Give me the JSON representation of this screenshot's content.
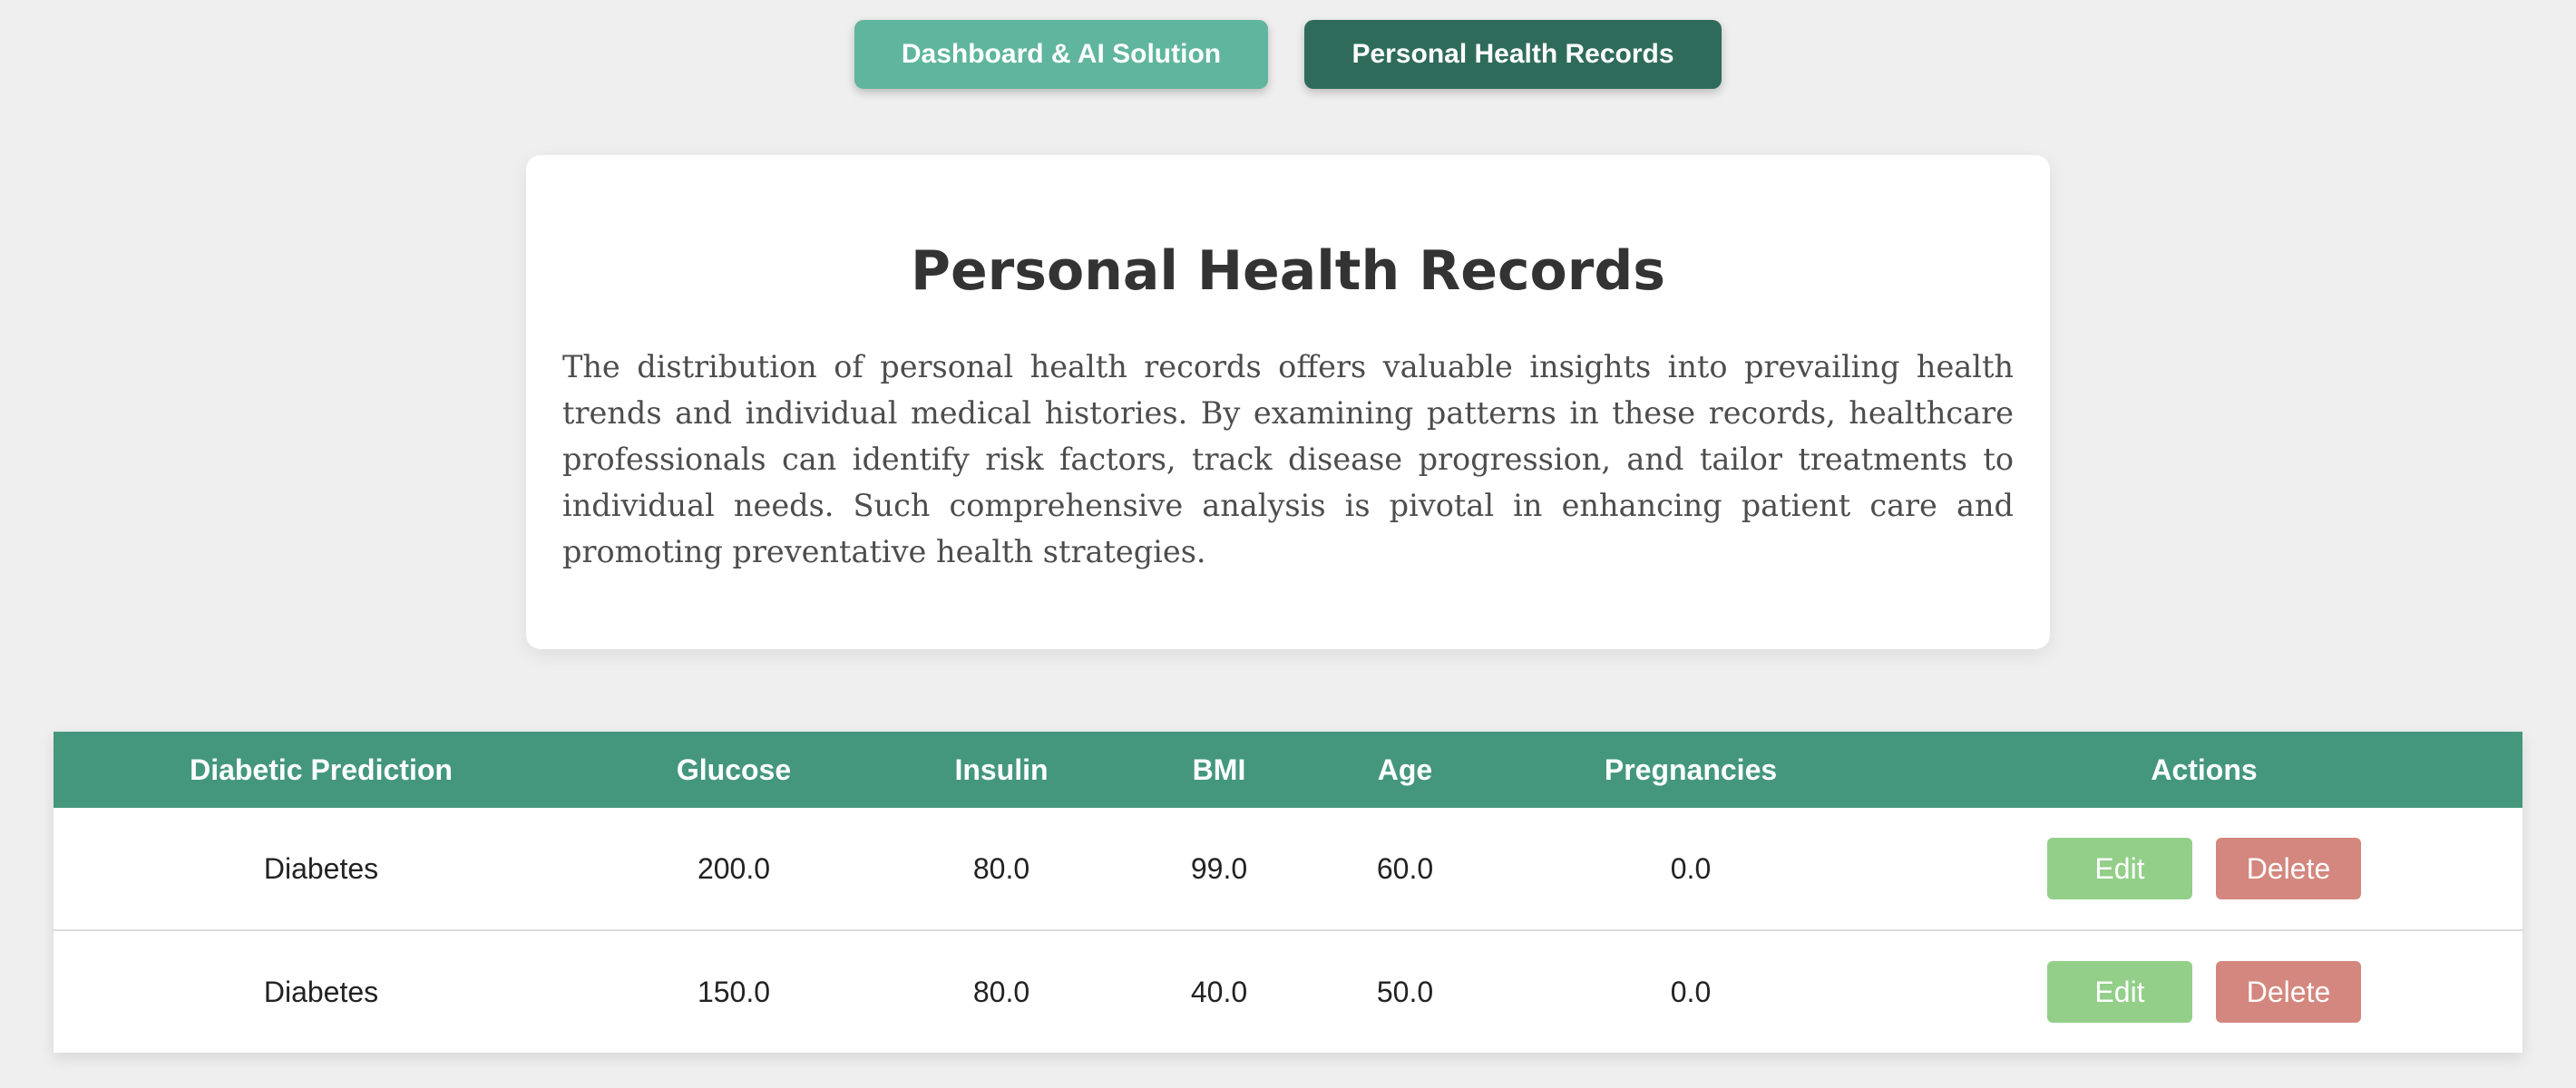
{
  "nav": {
    "dashboard_label": "Dashboard & AI Solution",
    "records_label": "Personal Health Records"
  },
  "intro": {
    "title": "Personal Health Records",
    "text": "The distribution of personal health records offers valuable insights into prevailing health trends and individual medical histories. By examining patterns in these records, healthcare professionals can identify risk factors, track disease progression, and tailor treatments to individual needs. Such comprehensive analysis is pivotal in enhancing patient care and promoting preventative health strategies."
  },
  "table": {
    "headers": [
      "Diabetic Prediction",
      "Glucose",
      "Insulin",
      "BMI",
      "Age",
      "Pregnancies",
      "Actions"
    ],
    "rows": [
      {
        "prediction": "Diabetes",
        "glucose": "200.0",
        "insulin": "80.0",
        "bmi": "99.0",
        "age": "60.0",
        "pregnancies": "0.0"
      },
      {
        "prediction": "Diabetes",
        "glucose": "150.0",
        "insulin": "80.0",
        "bmi": "40.0",
        "age": "50.0",
        "pregnancies": "0.0"
      }
    ],
    "edit_label": "Edit",
    "delete_label": "Delete"
  },
  "colors": {
    "background": "#efefef",
    "nav_dashboard": "#5fb59d",
    "nav_records": "#2f6b5b",
    "table_header": "#44977d",
    "edit_button": "#93cf89",
    "delete_button": "#d4877e"
  }
}
